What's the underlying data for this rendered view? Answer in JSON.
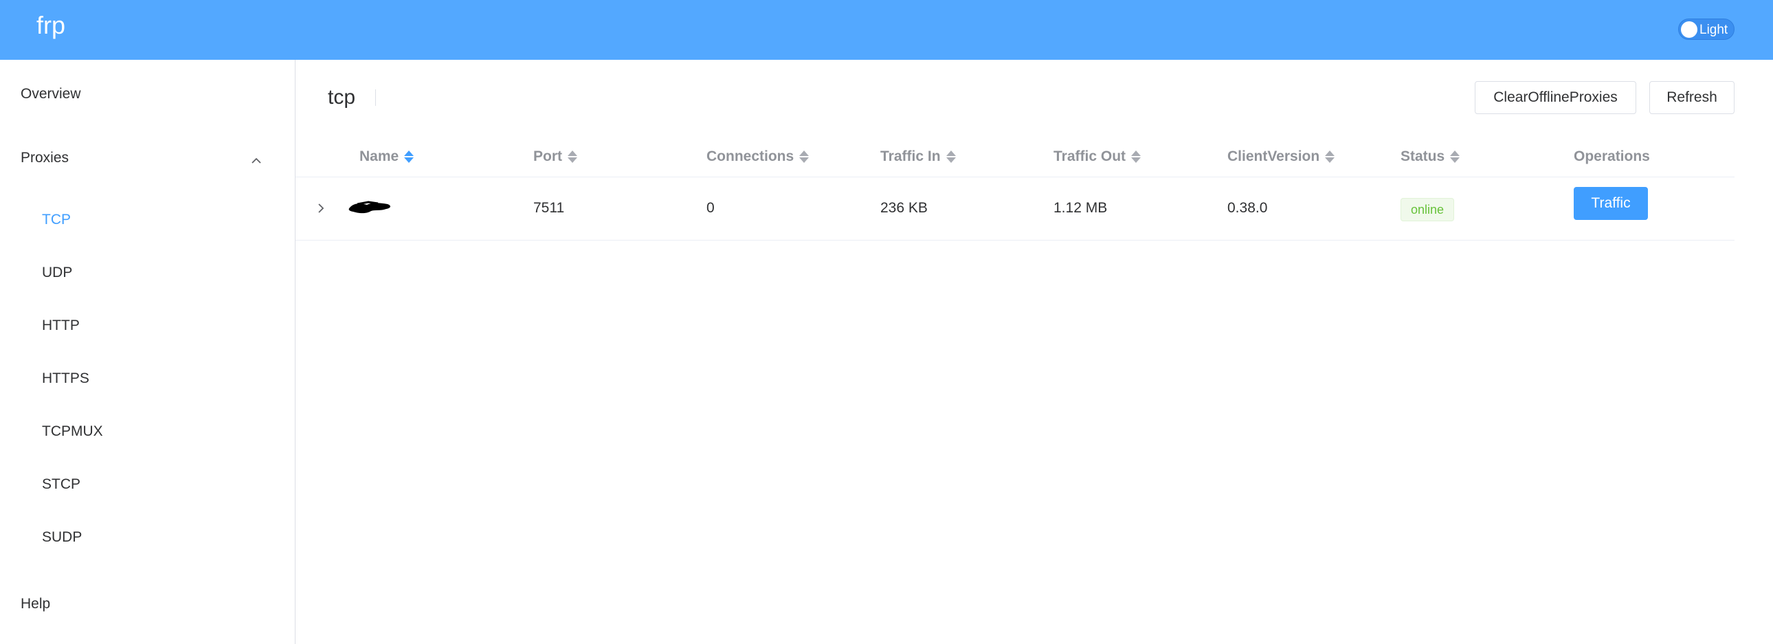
{
  "app": {
    "brand": "frp"
  },
  "header": {
    "theme_label": "Light"
  },
  "sidebar": {
    "overview": "Overview",
    "proxies": "Proxies",
    "proxy_types": [
      "TCP",
      "UDP",
      "HTTP",
      "HTTPS",
      "TCPMUX",
      "STCP",
      "SUDP"
    ],
    "help": "Help"
  },
  "page": {
    "title": "tcp"
  },
  "actions": {
    "clear_offline": "ClearOfflineProxies",
    "refresh": "Refresh"
  },
  "table": {
    "columns": [
      "Name",
      "Port",
      "Connections",
      "Traffic In",
      "Traffic Out",
      "ClientVersion",
      "Status",
      "Operations"
    ],
    "rows": [
      {
        "name": "",
        "port": "7511",
        "connections": "0",
        "traffic_in": "236 KB",
        "traffic_out": "1.12 MB",
        "client_version": "0.38.0",
        "status": "online",
        "operation": "Traffic"
      }
    ]
  },
  "colors": {
    "header": "#53a8ff",
    "accent": "#409eff",
    "online": "#67c23a"
  }
}
